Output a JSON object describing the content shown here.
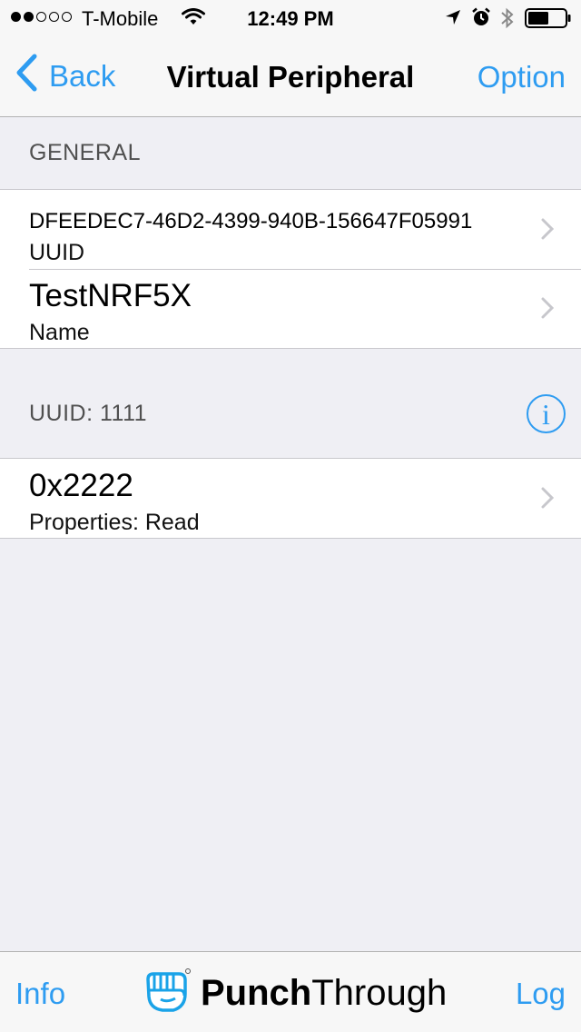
{
  "status_bar": {
    "carrier": "T-Mobile",
    "time": "12:49 PM",
    "signal_dots_filled": 2,
    "signal_dots_total": 5
  },
  "nav": {
    "back_label": "Back",
    "title": "Virtual Peripheral",
    "option_label": "Option"
  },
  "sections": {
    "general": {
      "header": "GENERAL",
      "rows": [
        {
          "title": "DFEEDEC7-46D2-4399-940B-156647F05991",
          "subtitle": "UUID"
        },
        {
          "title": "TestNRF5X",
          "subtitle": "Name"
        }
      ]
    },
    "service": {
      "header": "UUID: 1111",
      "info_glyph": "i",
      "rows": [
        {
          "title": "0x2222",
          "subtitle": "Properties: Read"
        }
      ]
    }
  },
  "toolbar": {
    "info_label": "Info",
    "logo_bold": "Punch",
    "logo_regular": "Through",
    "log_label": "Log"
  },
  "colors": {
    "accent": "#2e9cf1",
    "background": "#efeff4",
    "bar_background": "#f7f7f7"
  },
  "icons": [
    "wifi-icon",
    "location-arrow-icon",
    "alarm-clock-icon",
    "bluetooth-icon",
    "battery-icon",
    "chevron-left-icon",
    "chevron-right-icon",
    "info-icon",
    "fist-logo-icon"
  ]
}
